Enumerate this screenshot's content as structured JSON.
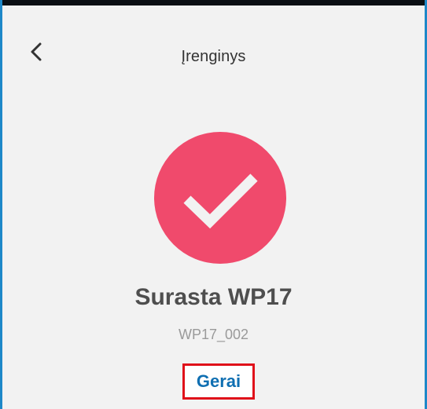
{
  "header": {
    "title": "Įrenginys",
    "back_icon": "chevron-left-icon"
  },
  "status": {
    "icon": "checkmark-icon",
    "color": "#f04a6c"
  },
  "device": {
    "name": "Surasta WP17",
    "id": "WP17_002"
  },
  "actions": {
    "ok_label": "Gerai",
    "ok_color": "#0f6fb2",
    "highlight_color": "#e0101a"
  },
  "colors": {
    "frame_border": "#1e88c8",
    "background": "#f2f2f2",
    "top_bar": "#0b0f14"
  }
}
